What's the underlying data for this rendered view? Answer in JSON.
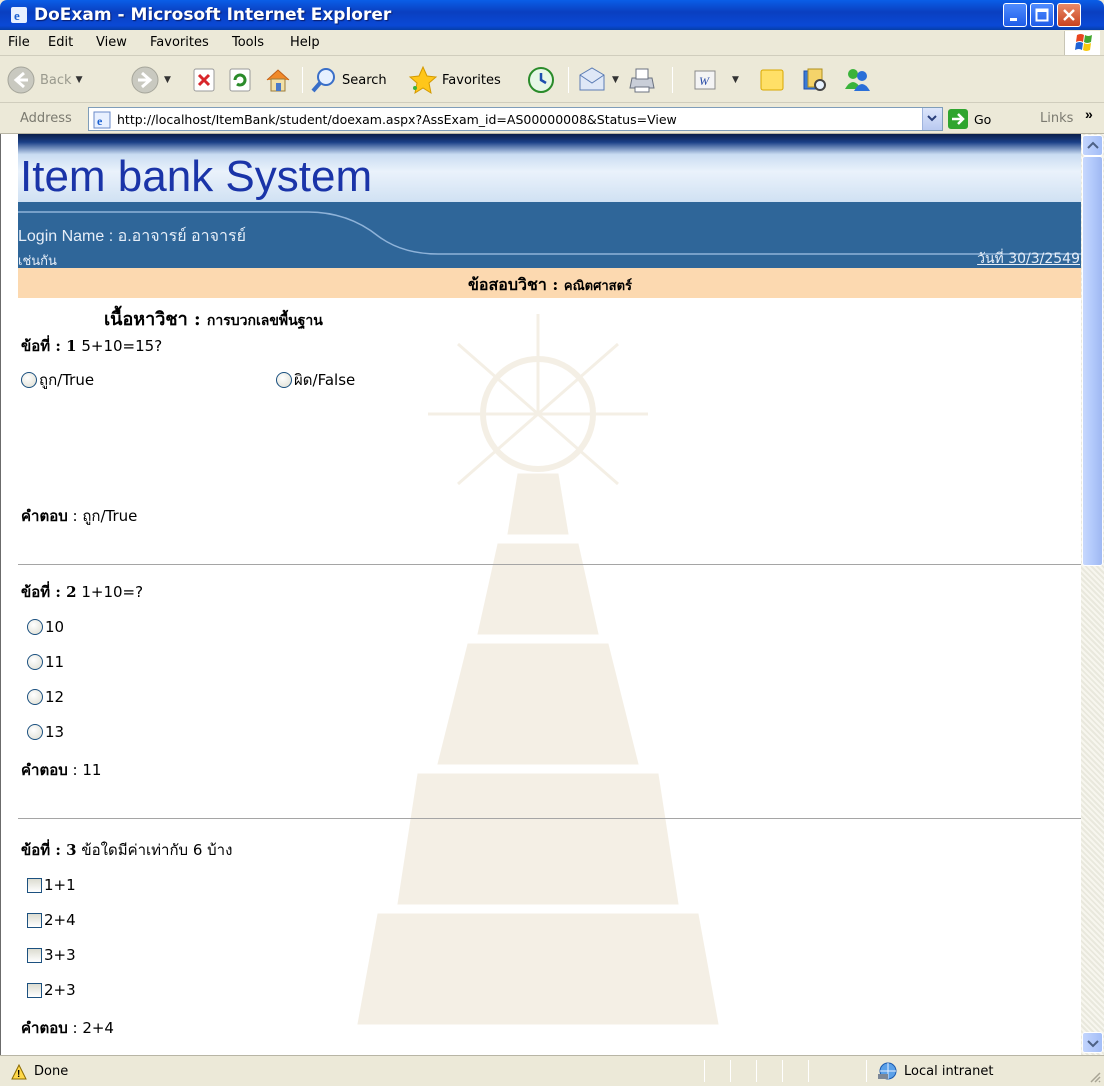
{
  "window": {
    "title": "DoExam - Microsoft Internet Explorer"
  },
  "menu": {
    "items": [
      "File",
      "Edit",
      "View",
      "Favorites",
      "Tools",
      "Help"
    ]
  },
  "toolbar": {
    "back_label": "Back",
    "search_label": "Search",
    "favorites_label": "Favorites"
  },
  "address": {
    "label": "Address",
    "url": "http://localhost/ItemBank/student/doexam.aspx?AssExam_id=AS00000008&Status=View",
    "go_label": "Go",
    "links_label": "Links",
    "links_chevron": "»"
  },
  "header": {
    "site_title": "Item bank System",
    "login_label": "Login Name : อ.อาจารย์ อาจารย์",
    "login_continuation": "เช่นกัน",
    "date_text": "วันที่ 30/3/2549"
  },
  "subject": {
    "label": "ข้อสอบวิชา :",
    "value": "คณิตศาสตร์"
  },
  "topic": {
    "label": "เนื้อหาวิชา :",
    "value": "การบวกเลขพื้นฐาน"
  },
  "questions": [
    {
      "label": "ข้อที่ : 1",
      "text": "5+10=15?",
      "type": "radio",
      "options": [
        "ถูก/True",
        "ผิด/False"
      ],
      "answer_label": "คำตอบ",
      "answer_value": " : ถูก/True"
    },
    {
      "label": "ข้อที่ : 2",
      "text": "1+10=?",
      "type": "radio",
      "options": [
        "10",
        "11",
        "12",
        "13"
      ],
      "answer_label": "คำตอบ",
      "answer_value": " : 11"
    },
    {
      "label": "ข้อที่ : 3",
      "text": "ข้อใดมีค่าเท่ากับ 6 บ้าง",
      "type": "checkbox",
      "options": [
        "1+1",
        "2+4",
        "3+3",
        "2+3"
      ],
      "answer_label": "คำตอบ",
      "answer_value": " : 2+4"
    }
  ],
  "status": {
    "text": "Done",
    "zone": "Local intranet"
  }
}
